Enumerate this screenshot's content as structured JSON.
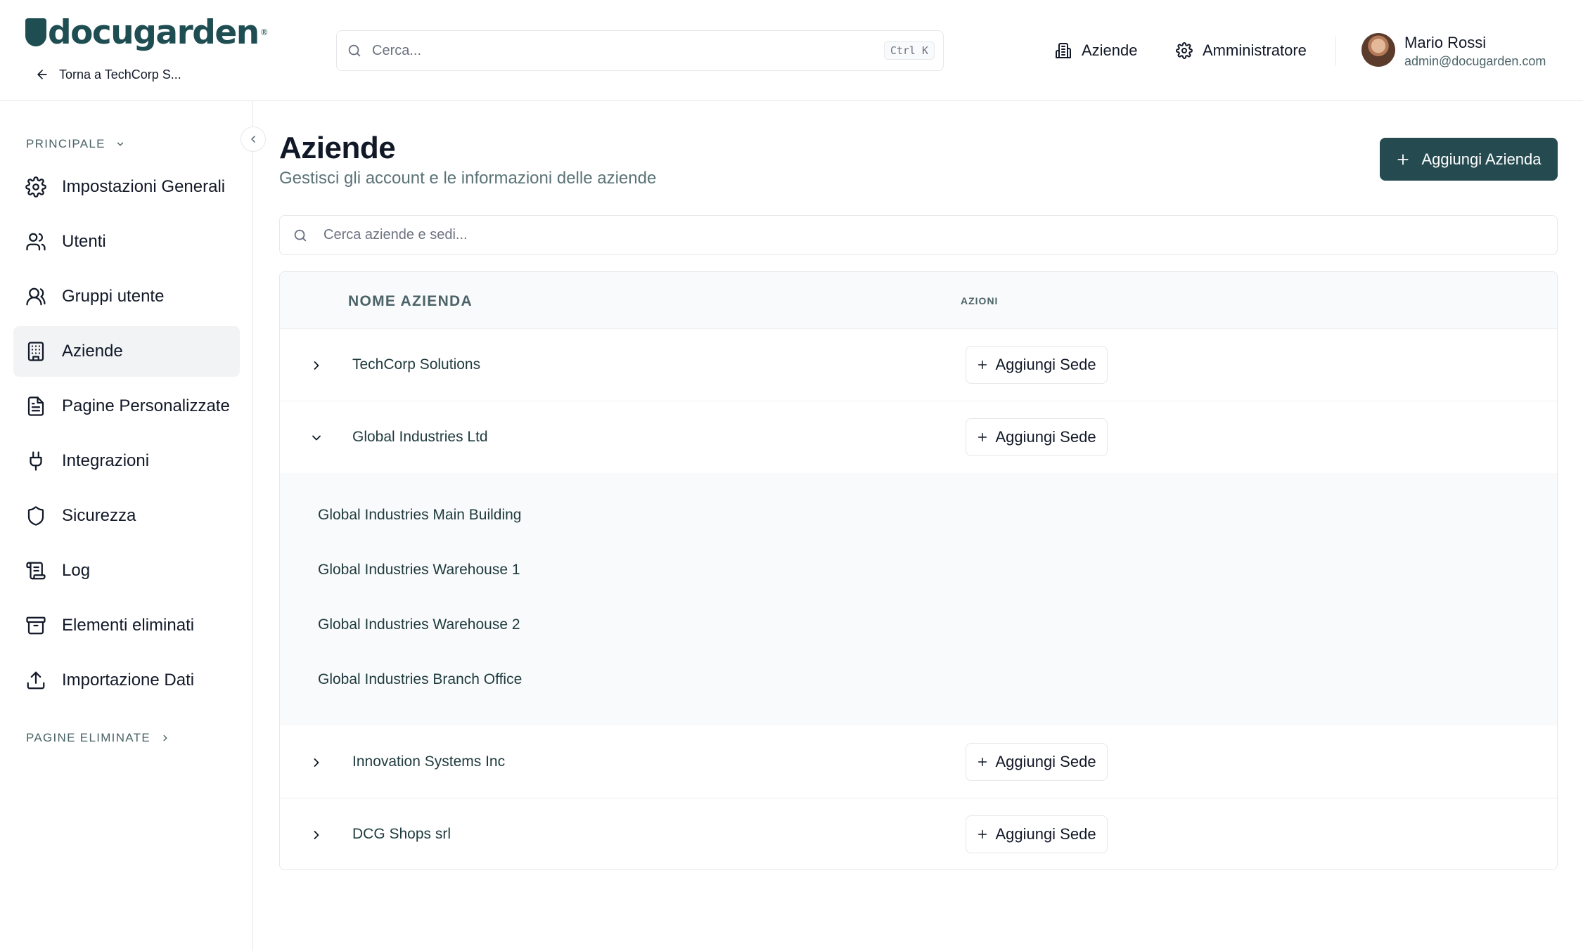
{
  "brand": {
    "name": "docugarden",
    "reg": "®"
  },
  "header": {
    "back_label": "Torna a TechCorp S...",
    "search_placeholder": "Cerca...",
    "search_shortcut": "Ctrl K",
    "nav": [
      {
        "label": "Aziende",
        "icon": "building-icon"
      },
      {
        "label": "Amministratore",
        "icon": "gear-icon"
      }
    ],
    "user": {
      "name": "Mario Rossi",
      "email": "admin@docugarden.com"
    }
  },
  "sidebar": {
    "section_main": "PRINCIPALE",
    "section_deleted": "PAGINE ELIMINATE",
    "items": [
      {
        "label": "Impostazioni Generali",
        "icon": "gear-icon",
        "active": false
      },
      {
        "label": "Utenti",
        "icon": "users-icon",
        "active": false
      },
      {
        "label": "Gruppi utente",
        "icon": "user-group-icon",
        "active": false
      },
      {
        "label": "Aziende",
        "icon": "building-icon",
        "active": true
      },
      {
        "label": "Pagine Personalizzate",
        "icon": "document-icon",
        "active": false
      },
      {
        "label": "Integrazioni",
        "icon": "plug-icon",
        "active": false
      },
      {
        "label": "Sicurezza",
        "icon": "shield-icon",
        "active": false
      },
      {
        "label": "Log",
        "icon": "scroll-icon",
        "active": false
      },
      {
        "label": "Elementi eliminati",
        "icon": "archive-icon",
        "active": false
      },
      {
        "label": "Importazione Dati",
        "icon": "upload-icon",
        "active": false
      }
    ]
  },
  "main": {
    "title": "Aziende",
    "subtitle": "Gestisci gli account e le informazioni delle aziende",
    "add_company_label": "Aggiungi Azienda",
    "search_placeholder": "Cerca aziende e sedi...",
    "table": {
      "col_name": "NOME AZIENDA",
      "col_actions": "AZIONI",
      "add_site_label": "Aggiungi Sede",
      "rows": [
        {
          "name": "TechCorp Solutions",
          "expanded": false
        },
        {
          "name": "Global Industries Ltd",
          "expanded": true,
          "sites": [
            "Global Industries Main Building",
            "Global Industries Warehouse 1",
            "Global Industries Warehouse 2",
            "Global Industries Branch Office"
          ]
        },
        {
          "name": "Innovation Systems Inc",
          "expanded": false
        },
        {
          "name": "DCG Shops srl",
          "expanded": false
        }
      ]
    }
  },
  "colors": {
    "brand": "#1e4d52",
    "primary_button": "#254b51",
    "muted_text": "#4b6367",
    "active_nav_bg": "#f1f3f5"
  }
}
